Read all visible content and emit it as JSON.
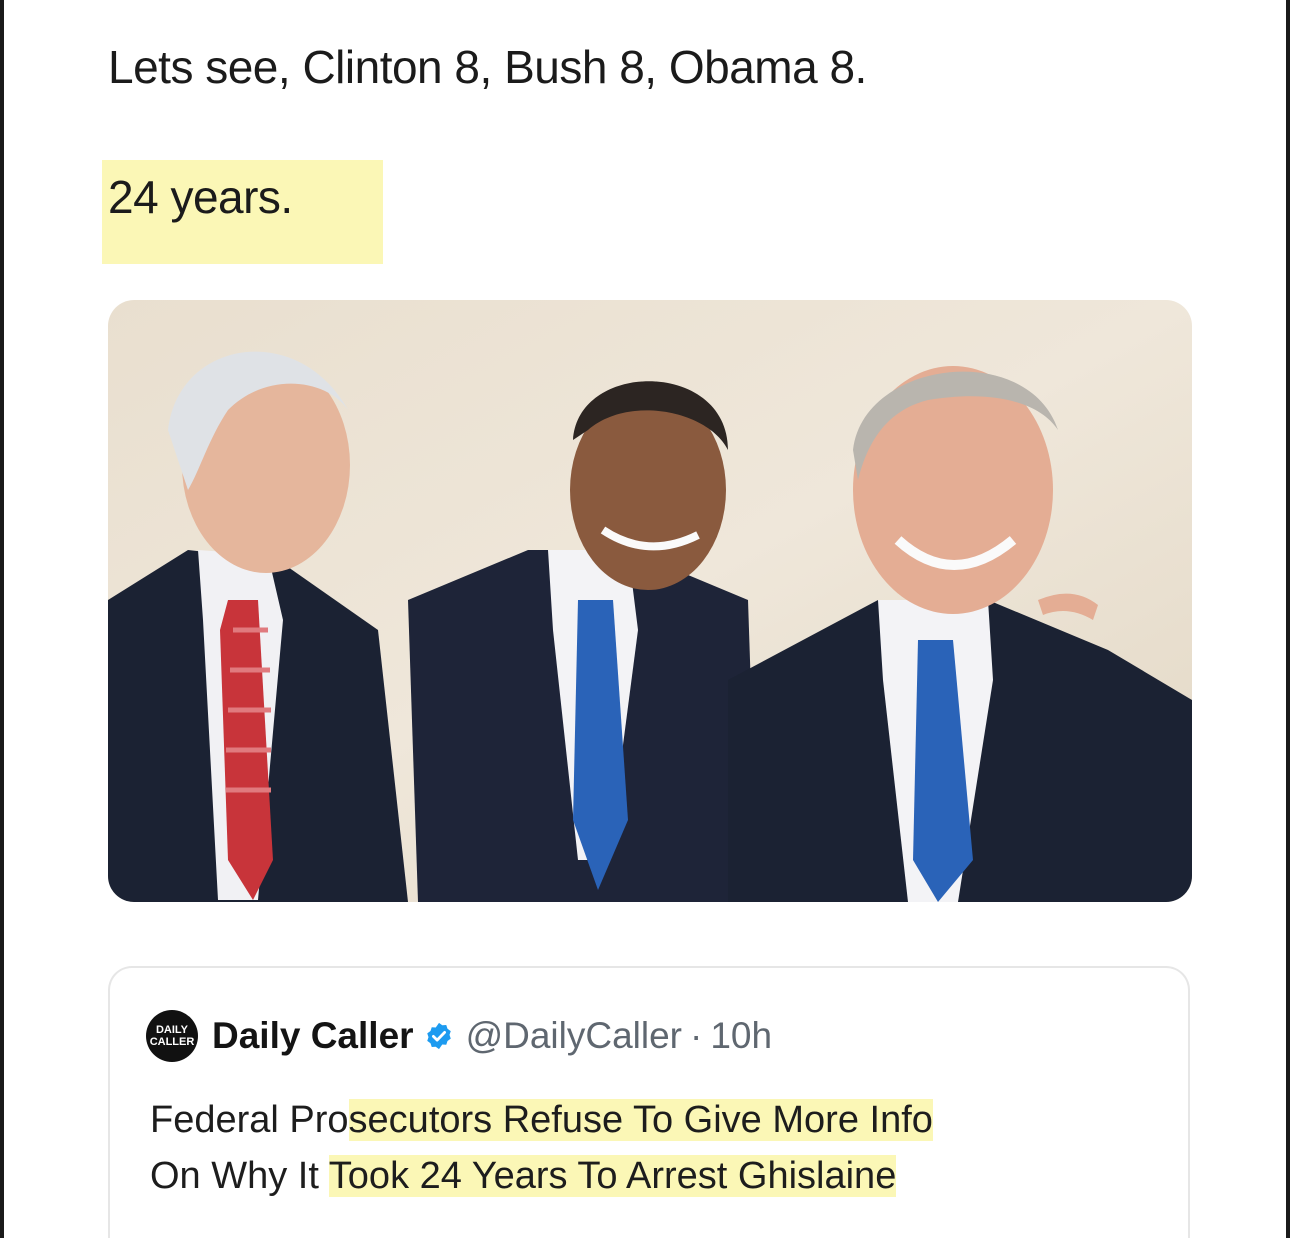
{
  "post": {
    "line1": "Lets see, Clinton 8, Bush 8, Obama 8.",
    "line2": "24 years."
  },
  "quoted_tweet": {
    "avatar_text_top": "DAILY",
    "avatar_text_bottom": "CALLER",
    "display_name": "Daily Caller",
    "handle": "@DailyCaller",
    "separator": "·",
    "time": "10h",
    "body_line1_plain": "Federal Pro",
    "body_line1_highlight": "secutors Refuse To Give More Info",
    "body_line2_plain": "On Why It ",
    "body_line2_highlight": "Took 24 Years To Arrest Ghislaine"
  },
  "colors": {
    "highlight": "#fbf7b6",
    "verified": "#1d9bf0",
    "suit": "#1b2233",
    "red_tie": "#c8343a",
    "blue_tie": "#2a63b8"
  },
  "icons": {
    "verified": "verified-badge-icon"
  }
}
